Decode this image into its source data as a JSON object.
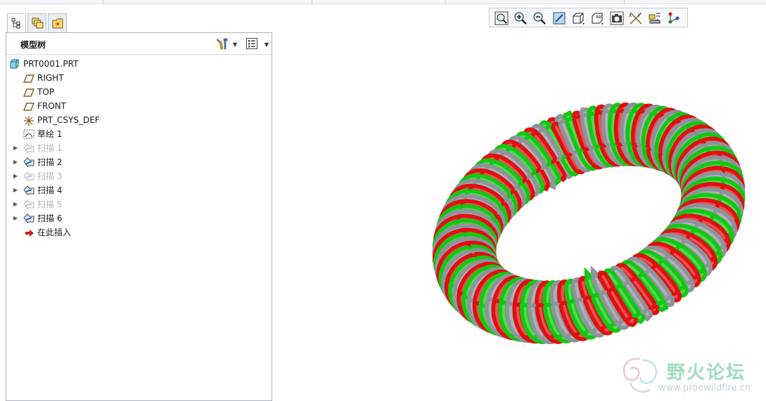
{
  "model_tree": {
    "title": "模型树",
    "items": [
      {
        "label": "PRT0001.PRT",
        "icon": "part-icon",
        "expandable": false,
        "dim": false
      },
      {
        "label": "RIGHT",
        "icon": "datum-plane-icon",
        "expandable": false,
        "dim": false
      },
      {
        "label": "TOP",
        "icon": "datum-plane-icon",
        "expandable": false,
        "dim": false
      },
      {
        "label": "FRONT",
        "icon": "datum-plane-icon",
        "expandable": false,
        "dim": false
      },
      {
        "label": "PRT_CSYS_DEF",
        "icon": "csys-icon",
        "expandable": false,
        "dim": false
      },
      {
        "label": "草绘 1",
        "icon": "sketch-icon",
        "expandable": false,
        "dim": false
      },
      {
        "label": "扫描 1",
        "icon": "sweep-icon",
        "expandable": true,
        "dim": true
      },
      {
        "label": "扫描 2",
        "icon": "sweep-icon",
        "expandable": true,
        "dim": false
      },
      {
        "label": "扫描 3",
        "icon": "sweep-icon",
        "expandable": true,
        "dim": true
      },
      {
        "label": "扫描 4",
        "icon": "sweep-icon",
        "expandable": true,
        "dim": false
      },
      {
        "label": "扫描 5",
        "icon": "sweep-icon",
        "expandable": true,
        "dim": true
      },
      {
        "label": "扫描 6",
        "icon": "sweep-icon",
        "expandable": true,
        "dim": false
      },
      {
        "label": "在此插入",
        "icon": "insert-here-arrow-icon",
        "expandable": false,
        "dim": false
      }
    ]
  },
  "tabs": [
    "model-tree-tab",
    "layers-tab",
    "folder-browser-tab"
  ],
  "toolbar": [
    "zoom-fit-icon",
    "zoom-in-icon",
    "zoom-out-icon",
    "repaint-icon",
    "display-style-icon",
    "saved-views-icon",
    "camera-icon",
    "datum-display-icon",
    "spin-center-icon",
    "annotation-icon"
  ],
  "coil_colors": [
    "#e01010",
    "#12c812",
    "#8e939b"
  ],
  "watermark": {
    "title": "野火论坛",
    "url": "www.proewildfire.cn"
  }
}
